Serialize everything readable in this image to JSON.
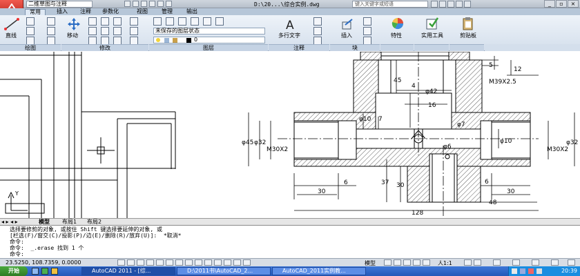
{
  "titlebar": {
    "workspace": "二维草图与注释",
    "file_title": "D:\\20...\\综合实例.dwg",
    "search_placeholder": "键入关键字或短语"
  },
  "ribbon_tabs": [
    "常用",
    "插入",
    "注释",
    "参数化",
    "视图",
    "管理",
    "输出"
  ],
  "ribbon": {
    "line_label": "直线",
    "move_label": "移动",
    "layer_state": "未保存的图层状态",
    "layer_name": "0",
    "mtext_label": "多行文字",
    "insert_label": "插入",
    "properties_label": "特性",
    "utilities_label": "实用工具",
    "clipboard_label": "剪贴板",
    "panels": [
      "绘图",
      "修改",
      "图层",
      "注释",
      "块"
    ]
  },
  "drawing": {
    "dims": {
      "d5": "5",
      "d12": "12",
      "thread_top": "M39X2.5",
      "d45": "45",
      "d4": "4",
      "phi42": "φ42",
      "d16": "16",
      "phi10": "φ10",
      "d7": "7",
      "phi7": "φ7",
      "phi45": "φ45",
      "phi32_l": "φ32",
      "m30_l": "M30X2",
      "phi6": "φ6",
      "phi10_r": "φ10",
      "m30_r": "M30X2",
      "phi32_r": "φ32",
      "d6_l": "6",
      "d30_l": "30",
      "d37": "37",
      "d30_c": "30",
      "d6_r": "6",
      "d30_r": "30",
      "d48": "48",
      "d128": "128"
    },
    "ucs_y": "Y"
  },
  "layout_tabs": [
    "模型",
    "布局1",
    "布局2"
  ],
  "command_lines": [
    "选择要修剪的对象, 或按住 Shift 键选择要延伸的对象, 或",
    "[栏选(F)/窗交(C)/投影(P)/边(E)/删除(R)/放弃(U)]:  *取消*",
    "命令:",
    "命令:  _.erase 找到 1 个",
    "命令:"
  ],
  "status": {
    "coords": "23.5250,  108.7359,  0.0000",
    "model": "模型",
    "scale": "人1:1"
  },
  "taskbar": {
    "start": "开始",
    "tasks": [
      "AutoCAD 2011 - [综...",
      "D:\\2011书\\AutoCAD_2...",
      "AutoCAD_2011实例教..."
    ],
    "time": "20:39"
  },
  "colors": {
    "titlebar": "#b7c0cb",
    "ribbon": "#d4dfec",
    "taskbar": "#2458b8",
    "start": "#3a9430"
  }
}
